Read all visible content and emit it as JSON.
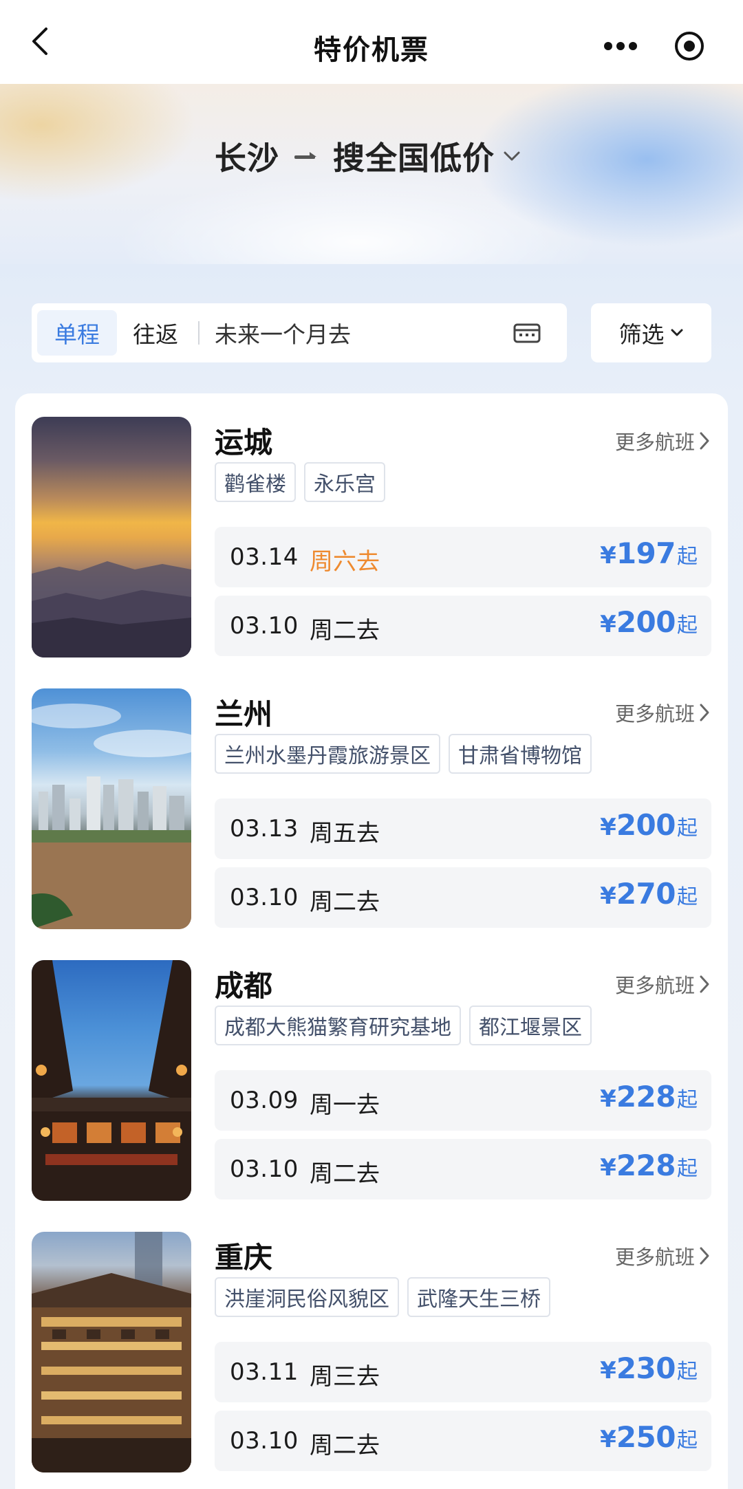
{
  "nav": {
    "title": "特价机票"
  },
  "hero": {
    "origin": "长沙",
    "destination": "搜全国低价"
  },
  "filters": {
    "tab_oneway": "单程",
    "tab_roundtrip": "往返",
    "date_range": "未来一个月去",
    "filter_label": "筛选"
  },
  "colors": {
    "accent": "#3a7be0",
    "highlight": "#ee8a2f"
  },
  "destinations": [
    {
      "name": "运城",
      "more": "更多航班",
      "tags": [
        "鹳雀楼",
        "永乐宫"
      ],
      "fares": [
        {
          "date": "03.14",
          "weekday": "周六去",
          "currency": "¥",
          "price": "197",
          "suffix": "起"
        },
        {
          "date": "03.10",
          "weekday": "周二去",
          "currency": "¥",
          "price": "200",
          "suffix": "起"
        }
      ]
    },
    {
      "name": "兰州",
      "more": "更多航班",
      "tags": [
        "兰州水墨丹霞旅游景区",
        "甘肃省博物馆"
      ],
      "fares": [
        {
          "date": "03.13",
          "weekday": "周五去",
          "currency": "¥",
          "price": "200",
          "suffix": "起"
        },
        {
          "date": "03.10",
          "weekday": "周二去",
          "currency": "¥",
          "price": "270",
          "suffix": "起"
        }
      ]
    },
    {
      "name": "成都",
      "more": "更多航班",
      "tags": [
        "成都大熊猫繁育研究基地",
        "都江堰景区"
      ],
      "fares": [
        {
          "date": "03.09",
          "weekday": "周一去",
          "currency": "¥",
          "price": "228",
          "suffix": "起"
        },
        {
          "date": "03.10",
          "weekday": "周二去",
          "currency": "¥",
          "price": "228",
          "suffix": "起"
        }
      ]
    },
    {
      "name": "重庆",
      "more": "更多航班",
      "tags": [
        "洪崖洞民俗风貌区",
        "武隆天生三桥"
      ],
      "fares": [
        {
          "date": "03.11",
          "weekday": "周三去",
          "currency": "¥",
          "price": "230",
          "suffix": "起"
        },
        {
          "date": "03.10",
          "weekday": "周二去",
          "currency": "¥",
          "price": "250",
          "suffix": "起"
        }
      ]
    }
  ]
}
